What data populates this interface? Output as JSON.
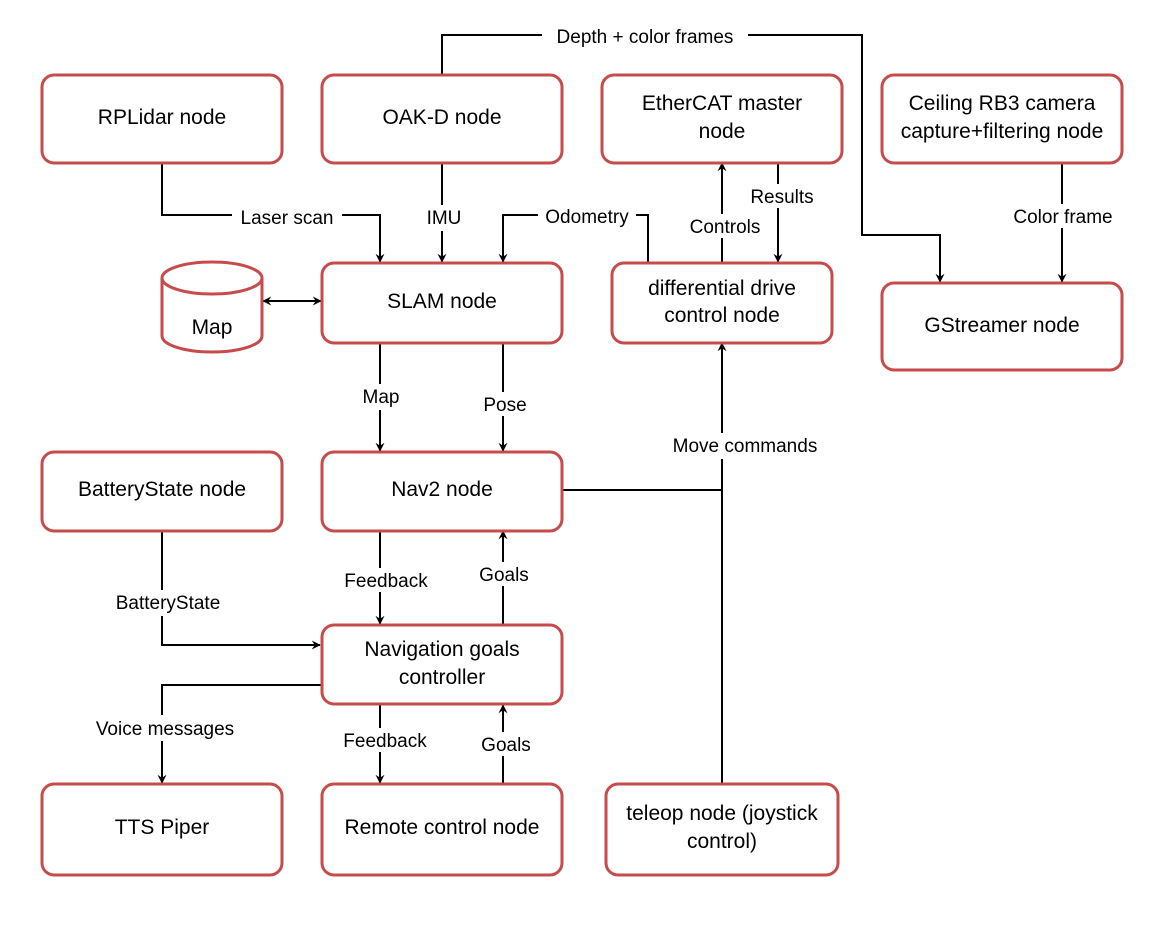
{
  "diagram": {
    "colors": {
      "node_stroke": "#c74b4b",
      "edge": "#000000",
      "background": "#ffffff"
    },
    "nodes": {
      "rplidar": {
        "lines": [
          "RPLidar node"
        ]
      },
      "oakd": {
        "lines": [
          "OAK-D node"
        ]
      },
      "ethercat": {
        "lines": [
          "EtherCAT master",
          "node"
        ]
      },
      "ceiling": {
        "lines": [
          "Ceiling RB3 camera",
          "capture+filtering node"
        ]
      },
      "map": {
        "lines": [
          "Map"
        ]
      },
      "slam": {
        "lines": [
          "SLAM node"
        ]
      },
      "diffdrive": {
        "lines": [
          "differential drive",
          "control node"
        ]
      },
      "gstreamer": {
        "lines": [
          "GStreamer node"
        ]
      },
      "battery": {
        "lines": [
          "BatteryState node"
        ]
      },
      "nav2": {
        "lines": [
          "Nav2 node"
        ]
      },
      "navgoals": {
        "lines": [
          "Navigation goals",
          "controller"
        ]
      },
      "tts": {
        "lines": [
          "TTS Piper"
        ]
      },
      "remote": {
        "lines": [
          "Remote control node"
        ]
      },
      "teleop": {
        "lines": [
          "teleop node (joystick",
          "control)"
        ]
      }
    },
    "edges": {
      "depth_color": "Depth + color frames",
      "laser_scan": "Laser scan",
      "imu": "IMU",
      "odometry": "Odometry",
      "controls": "Controls",
      "results": "Results",
      "color_frame": "Color frame",
      "map": "Map",
      "pose": "Pose",
      "move_commands": "Move commands",
      "feedback_1": "Feedback",
      "goals_1": "Goals",
      "battery_state": "BatteryState",
      "voice_messages": "Voice messages",
      "feedback_2": "Feedback",
      "goals_2": "Goals"
    }
  }
}
